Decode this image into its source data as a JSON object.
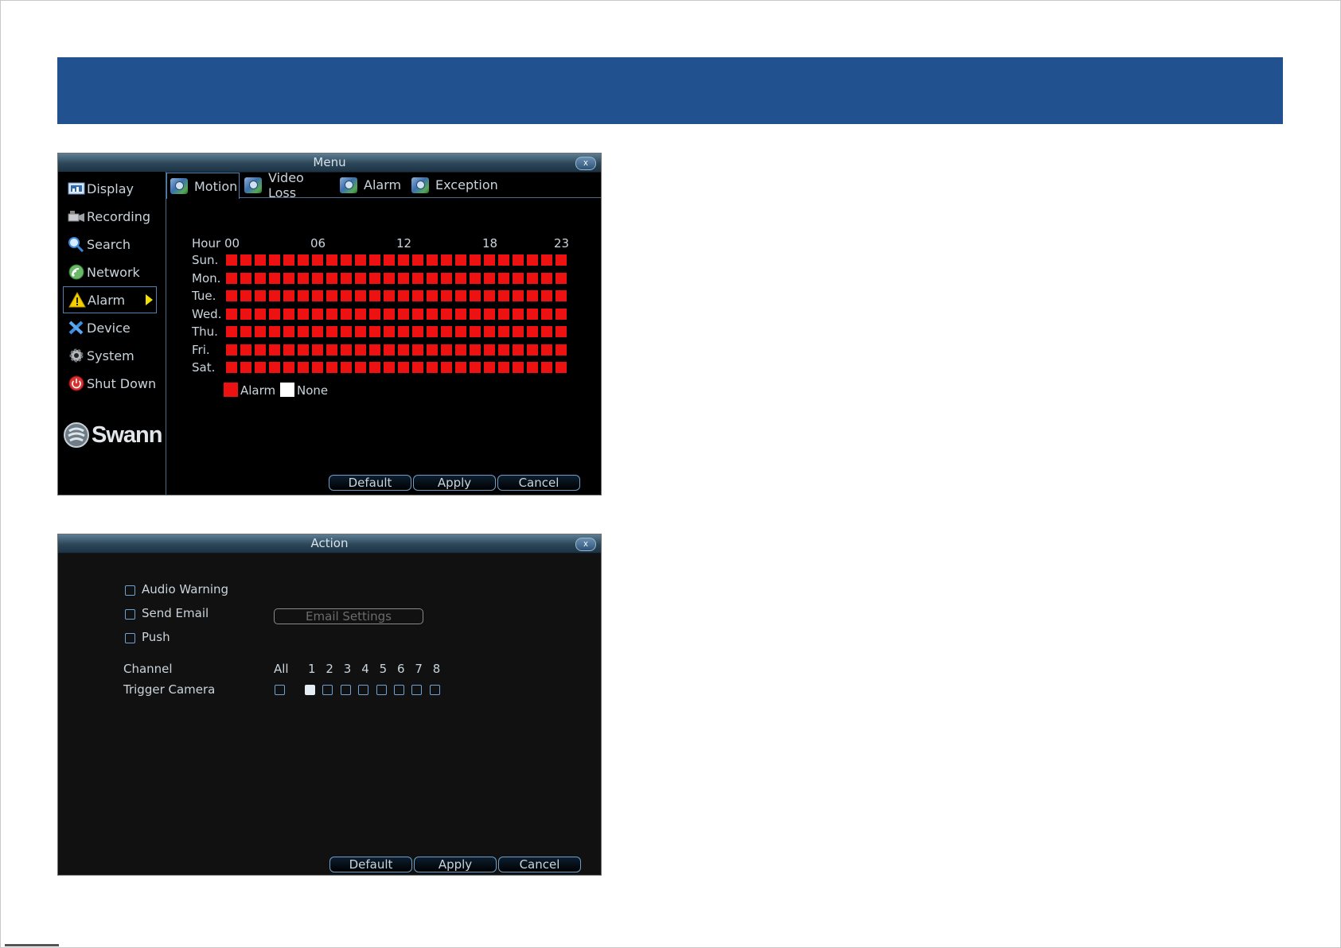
{
  "colors": {
    "banner": "#22518f",
    "alarm": "#ee1111",
    "none": "#ffffff",
    "accent": "#4f7fb3"
  },
  "menu_window": {
    "title": "Menu",
    "close_label": "x",
    "sidebar": [
      {
        "label": "Display",
        "icon": "display-icon"
      },
      {
        "label": "Recording",
        "icon": "recording-icon"
      },
      {
        "label": "Search",
        "icon": "search-icon"
      },
      {
        "label": "Network",
        "icon": "network-icon"
      },
      {
        "label": "Alarm",
        "icon": "warning-icon",
        "active": true
      },
      {
        "label": "Device",
        "icon": "device-icon"
      },
      {
        "label": "System",
        "icon": "gear-icon"
      },
      {
        "label": "Shut Down",
        "icon": "power-icon"
      }
    ],
    "brand": "Swann",
    "tabs": [
      {
        "label": "Motion",
        "active": true
      },
      {
        "label": "Video Loss"
      },
      {
        "label": "Alarm"
      },
      {
        "label": "Exception"
      }
    ],
    "schedule": {
      "hour_label": "Hour",
      "hour_marks": [
        "00",
        "06",
        "12",
        "18",
        "23"
      ],
      "days": [
        "Sun.",
        "Mon.",
        "Tue.",
        "Wed.",
        "Thu.",
        "Fri.",
        "Sat."
      ],
      "hours_per_day": 24,
      "all_hours_state": "Alarm",
      "legend": [
        {
          "label": "Alarm",
          "color": "#ee1111"
        },
        {
          "label": "None",
          "color": "#ffffff"
        }
      ]
    },
    "buttons": {
      "default": "Default",
      "apply": "Apply",
      "cancel": "Cancel"
    }
  },
  "action_window": {
    "title": "Action",
    "close_label": "x",
    "options": [
      {
        "label": "Audio Warning",
        "checked": false
      },
      {
        "label": "Send Email",
        "checked": false
      },
      {
        "label": "Push",
        "checked": false
      }
    ],
    "email_settings_label": "Email Settings",
    "channel_label": "Channel",
    "trigger_label": "Trigger Camera",
    "all_label": "All",
    "channels": [
      {
        "num": "1",
        "checked": true
      },
      {
        "num": "2",
        "checked": false
      },
      {
        "num": "3",
        "checked": false
      },
      {
        "num": "4",
        "checked": false
      },
      {
        "num": "5",
        "checked": false
      },
      {
        "num": "6",
        "checked": false
      },
      {
        "num": "7",
        "checked": false
      },
      {
        "num": "8",
        "checked": false
      }
    ],
    "buttons": {
      "default": "Default",
      "apply": "Apply",
      "cancel": "Cancel"
    }
  }
}
